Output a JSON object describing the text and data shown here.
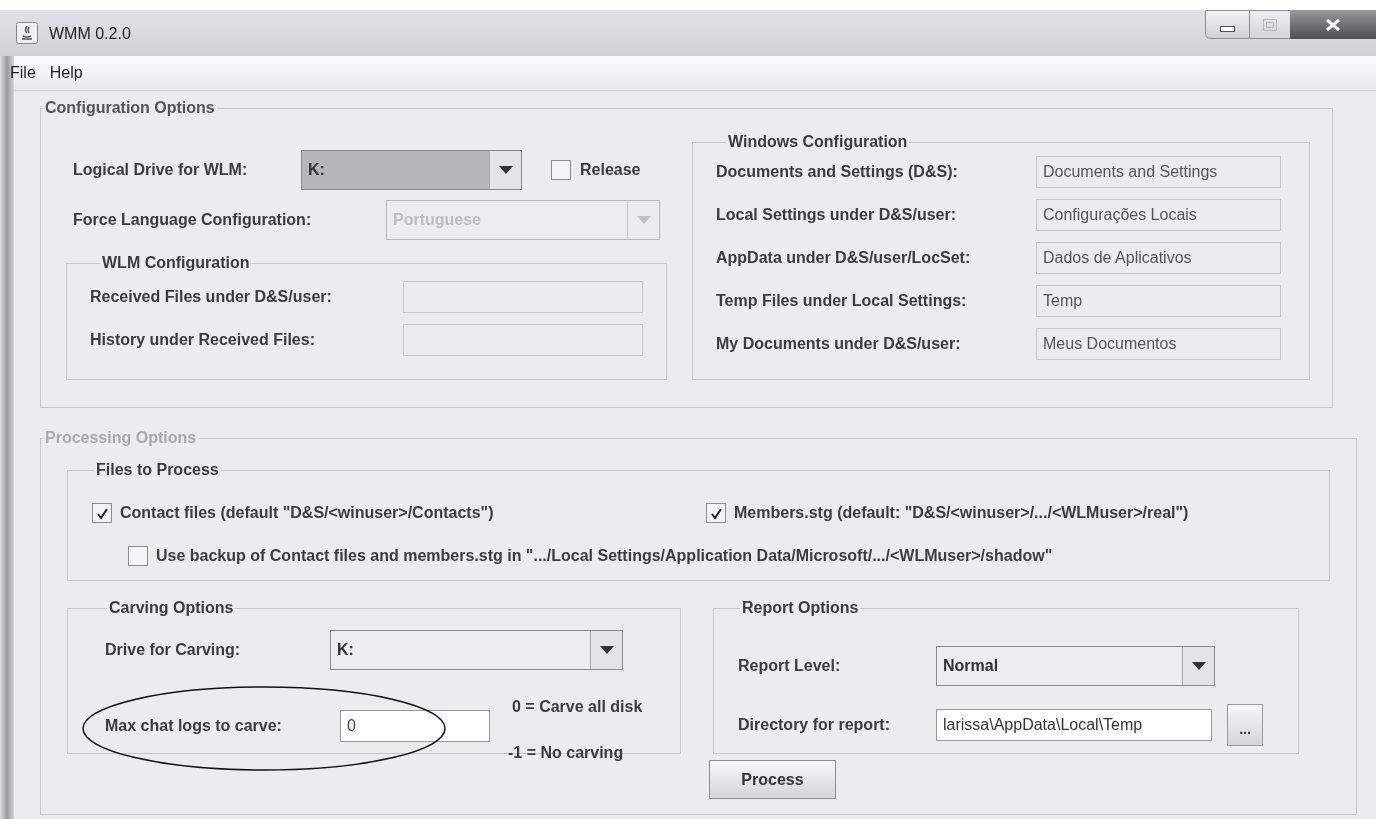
{
  "window": {
    "title": "WMM 0.2.0"
  },
  "menu": [
    {
      "label": "File"
    },
    {
      "label": "Help"
    }
  ],
  "configuration_options": {
    "title": "Configuration Options",
    "logical_drive": {
      "label": "Logical Drive for WLM:",
      "value": "K:",
      "focused": true
    },
    "release": {
      "label": "Release",
      "checked": false
    },
    "force_language": {
      "label": "Force Language Configuration:",
      "value": "Portuguese",
      "disabled": true
    },
    "wlm_configuration": {
      "title": "WLM Configuration",
      "fields": [
        {
          "label": "Received Files under D&S/user:"
        },
        {
          "label": "History under Received Files:"
        }
      ]
    },
    "windows_configuration": {
      "title": "Windows Configuration",
      "fields": [
        {
          "label": "Documents and Settings (D&S):",
          "value": "Documents and Settings"
        },
        {
          "label": "Local Settings under D&S/user:",
          "value": "Configurações Locais"
        },
        {
          "label": "AppData under D&S/user/LocSet:",
          "value": "Dados de Aplicativos"
        },
        {
          "label": "Temp Files under Local Settings:",
          "value": "Temp"
        },
        {
          "label": "My Documents under D&S/user:",
          "value": "Meus Documentos"
        }
      ]
    }
  },
  "processing_options": {
    "title": "Processing Options",
    "disabled": true,
    "files_to_process": {
      "title": "Files to Process",
      "options": [
        {
          "label": "Contact files (default \"D&S/<winuser>/Contacts\")",
          "checked": true
        },
        {
          "label": "Members.stg  (default: \"D&S/<winuser>/.../<WLMuser>/real\")",
          "checked": true
        },
        {
          "label": "Use backup of Contact files and members.stg in \".../Local Settings/Application Data/Microsoft/.../<WLMuser>/shadow\"",
          "checked": false
        }
      ]
    },
    "carving_options": {
      "title": "Carving Options",
      "drive": {
        "label": "Drive for Carving:",
        "value": "K:"
      },
      "max_chat_logs": {
        "label": "Max chat logs to carve:",
        "value": "0"
      },
      "hints": [
        "0 = Carve all disk",
        "-1 = No carving"
      ]
    },
    "report_options": {
      "title": "Report Options",
      "level": {
        "label": "Report Level:",
        "value": "Normal"
      },
      "directory": {
        "label": "Directory for report:",
        "value": "larissa\\AppData\\Local\\Temp"
      },
      "browse_button": "..."
    },
    "process_button": "Process"
  }
}
